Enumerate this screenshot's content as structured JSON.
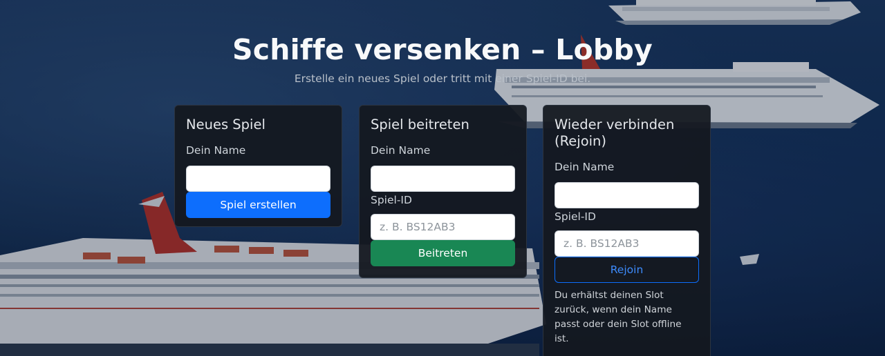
{
  "page": {
    "title": "Schiffe versenken – Lobby",
    "subtitle": "Erstelle ein neues Spiel oder tritt mit einer Spiel-ID bei."
  },
  "cards": {
    "new_game": {
      "title": "Neues Spiel",
      "name_label": "Dein Name",
      "name_value": "",
      "name_placeholder": "",
      "button": "Spiel erstellen"
    },
    "join_game": {
      "title": "Spiel beitreten",
      "name_label": "Dein Name",
      "name_value": "",
      "name_placeholder": "",
      "id_label": "Spiel-ID",
      "id_placeholder": "z. B. BS12AB3",
      "button": "Beitreten"
    },
    "rejoin": {
      "title": "Wieder verbinden (Rejoin)",
      "name_label": "Dein Name",
      "name_value": "",
      "name_placeholder": "",
      "id_label": "Spiel-ID",
      "id_placeholder": "z. B. BS12AB3",
      "button": "Rejoin",
      "note": "Du erhältst deinen Slot zurück, wenn dein Name passt oder dein Slot offline ist."
    }
  },
  "colors": {
    "primary": "#0d6efd",
    "success": "#198754",
    "card_bg": "#14181f"
  }
}
